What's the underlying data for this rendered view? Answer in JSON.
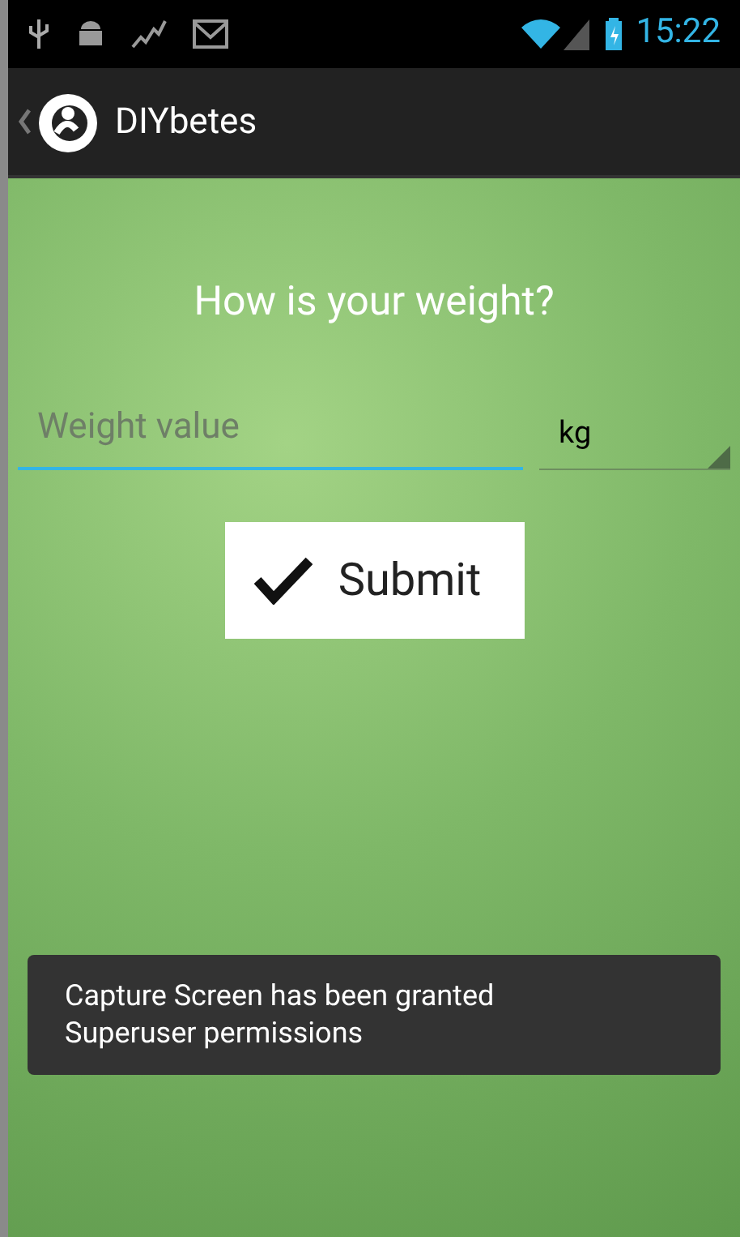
{
  "status_bar": {
    "time": "15:22"
  },
  "action_bar": {
    "title": "DIYbetes"
  },
  "question": "How is your weight?",
  "weight_field": {
    "placeholder": "Weight value",
    "focused": true
  },
  "unit_spinner": {
    "value": "kg"
  },
  "submit_button": {
    "label": "Submit"
  },
  "toast": {
    "message": "Capture Screen has been granted Superuser permissions"
  }
}
